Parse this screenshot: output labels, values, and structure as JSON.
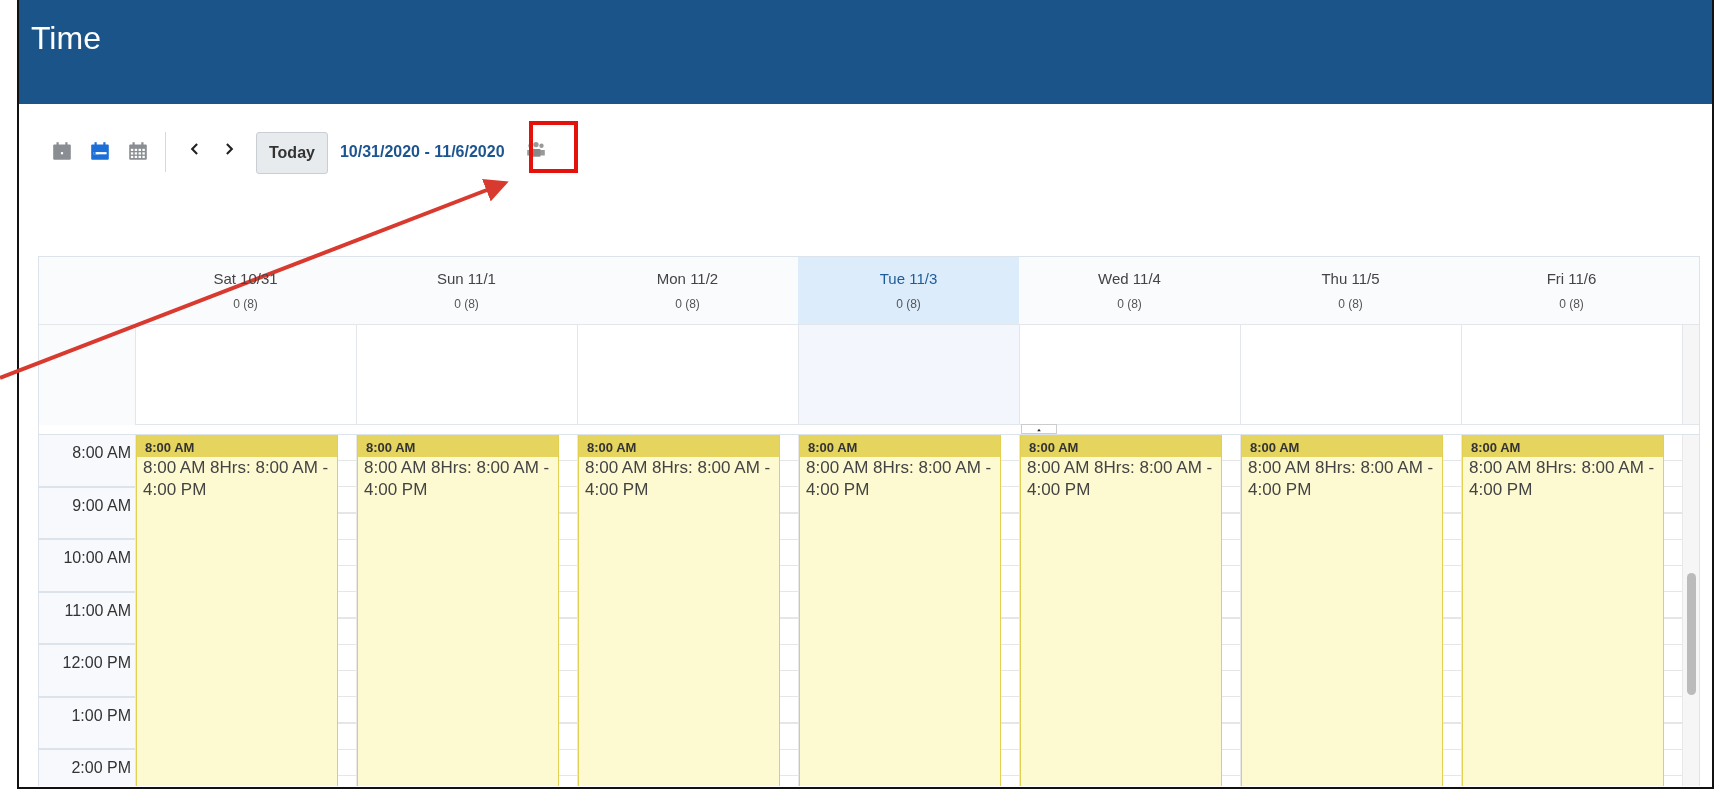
{
  "window": {
    "title": "Time"
  },
  "toolbar": {
    "views": [
      {
        "kind": "day",
        "selected": false
      },
      {
        "kind": "week",
        "selected": true
      },
      {
        "kind": "month",
        "selected": false
      }
    ],
    "today_button": "Today",
    "date_range": "10/31/2020 - 11/6/2020"
  },
  "days": [
    {
      "label": "Sat 10/31",
      "hours": "0 (8)",
      "selected": false,
      "event": {
        "time": "8:00 AM",
        "text": "8:00 AM 8Hrs: 8:00 AM - 4:00 PM"
      }
    },
    {
      "label": "Sun 11/1",
      "hours": "0 (8)",
      "selected": false,
      "event": {
        "time": "8:00 AM",
        "text": "8:00 AM 8Hrs: 8:00 AM - 4:00 PM"
      }
    },
    {
      "label": "Mon 11/2",
      "hours": "0 (8)",
      "selected": false,
      "event": {
        "time": "8:00 AM",
        "text": "8:00 AM 8Hrs: 8:00 AM - 4:00 PM"
      }
    },
    {
      "label": "Tue 11/3",
      "hours": "0 (8)",
      "selected": true,
      "event": {
        "time": "8:00 AM",
        "text": "8:00 AM 8Hrs: 8:00 AM - 4:00 PM"
      }
    },
    {
      "label": "Wed 11/4",
      "hours": "0 (8)",
      "selected": false,
      "event": {
        "time": "8:00 AM",
        "text": "8:00 AM 8Hrs: 8:00 AM - 4:00 PM"
      }
    },
    {
      "label": "Thu 11/5",
      "hours": "0 (8)",
      "selected": false,
      "event": {
        "time": "8:00 AM",
        "text": "8:00 AM 8Hrs: 8:00 AM - 4:00 PM"
      }
    },
    {
      "label": "Fri 11/6",
      "hours": "0 (8)",
      "selected": false,
      "event": {
        "time": "8:00 AM",
        "text": "8:00 AM 8Hrs: 8:00 AM - 4:00 PM"
      }
    }
  ],
  "time_slots": [
    "8:00 AM",
    "9:00 AM",
    "10:00 AM",
    "11:00 AM",
    "12:00 PM",
    "1:00 PM",
    "2:00 PM"
  ]
}
